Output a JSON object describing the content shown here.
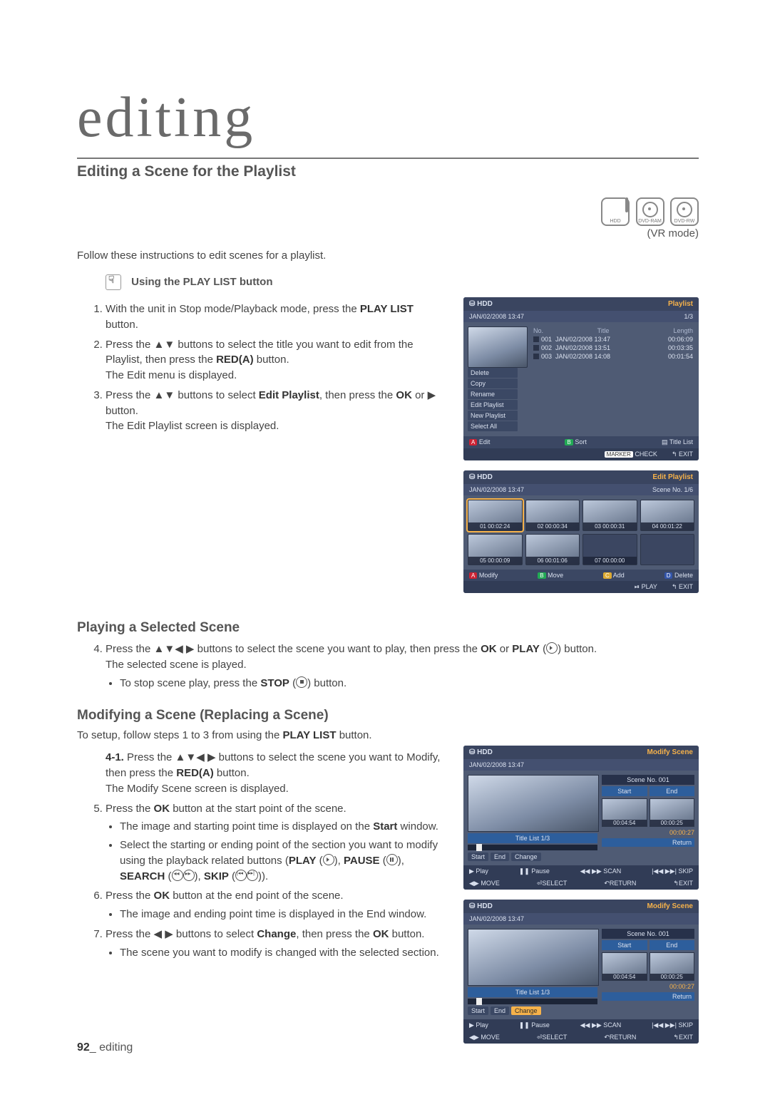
{
  "chapter_title": "editing",
  "h2": "Editing a Scene for the Playlist",
  "media_icons": {
    "hdd": "HDD",
    "dvd_ram": "DVD-RAM",
    "dvd_rw": "DVD-RW"
  },
  "vr_mode": "(VR mode)",
  "intro": "Follow these instructions to edit scenes for a playlist.",
  "using_btn": "Using the PLAY LIST button",
  "steps_1_3": [
    "With the unit in Stop mode/Playback mode, press the PLAY LIST button.",
    "Press the ▲▼ buttons to select the title you want to edit from the Playlist, then press the RED(A) button. The Edit menu is displayed.",
    "Press the ▲▼ buttons to select Edit Playlist, then press the OK or ▶ button. The Edit Playlist screen is displayed."
  ],
  "osd_playlist": {
    "hdd": "HDD",
    "corner": "Playlist",
    "datetime": "JAN/02/2008 13:47",
    "page": "1/3",
    "menu": [
      "Delete",
      "Copy",
      "Rename",
      "Edit Playlist",
      "New Playlist",
      "Select All"
    ],
    "cols": {
      "no": "No.",
      "title": "Title",
      "len": "Length"
    },
    "rows": [
      {
        "no": "001",
        "title": "JAN/02/2008 13:47",
        "len": "00:06:09"
      },
      {
        "no": "002",
        "title": "JAN/02/2008 13:51",
        "len": "00:03:35"
      },
      {
        "no": "003",
        "title": "JAN/02/2008 14:08",
        "len": "00:01:54"
      }
    ],
    "foot_edit": "Edit",
    "foot_sort": "Sort",
    "foot_titlelist": "Title List",
    "foot_check": "CHECK",
    "foot_marker": "MARKER",
    "foot_exit": "EXIT"
  },
  "osd_edit_playlist": {
    "hdd": "HDD",
    "corner": "Edit Playlist",
    "datetime": "JAN/02/2008 13:47",
    "scene_no": "Scene No. 1/6",
    "cells": [
      {
        "n": "01",
        "t": "00:02:24",
        "sel": true
      },
      {
        "n": "02",
        "t": "00:00:34"
      },
      {
        "n": "03",
        "t": "00:00:31"
      },
      {
        "n": "04",
        "t": "00:01:22"
      },
      {
        "n": "05",
        "t": "00:00:09"
      },
      {
        "n": "06",
        "t": "00:01:06"
      },
      {
        "n": "07",
        "t": "00:00:00",
        "empty": true
      },
      {
        "empty_only": true
      }
    ],
    "foot_modify": "Modify",
    "foot_move": "Move",
    "foot_add": "Add",
    "foot_delete": "Delete",
    "foot_play": "PLAY",
    "foot_exit": "EXIT"
  },
  "h3_play": "Playing a Selected Scene",
  "step4": "Press the ▲▼◀ ▶ buttons to select the scene you want to play, then press the OK or PLAY ( ) button. The selected scene is played.",
  "step4_bullet": "To stop scene play, press the STOP ( ) button.",
  "h3_modify": "Modifying a Scene (Replacing a Scene)",
  "modify_intro": "To setup, follow steps 1 to 3 from using the PLAY LIST button.",
  "step4_1_label": "4-1.",
  "step4_1": "Press the ▲▼◀ ▶ buttons to select the scene you want to Modify, then press the RED(A) button. The Modify Scene screen is displayed.",
  "steps_5_7": [
    {
      "t": "Press the OK button at the start point of the scene.",
      "b": [
        "The image and starting point time is displayed on the Start window.",
        "Select the starting or ending point of the section you want to modify using the playback related buttons (PLAY ( ), PAUSE ( ), SEARCH ( )( ), SKIP ( )( ))."
      ]
    },
    {
      "t": "Press the OK button at the end point of the scene.",
      "b": [
        "The image and ending point time is displayed in the End window."
      ]
    },
    {
      "t": "Press the ◀ ▶ buttons to select Change, then press the OK button.",
      "b": [
        "The scene you want to modify is changed with the selected section."
      ]
    }
  ],
  "osd_modify_a": {
    "hdd": "HDD",
    "corner": "Modify Scene",
    "datetime": "JAN/02/2008 13:47",
    "title_list": "Title List  1/3",
    "scene_no": "Scene No. 001",
    "start": "Start",
    "end": "End",
    "start_t": "00:04:54",
    "end_t": "00:00:25",
    "duration": "00:00:27",
    "return": "Return",
    "btns": [
      "Start",
      "End",
      "Change"
    ],
    "hl_btn": "Change",
    "foot_play": "▶ Play",
    "foot_pause": "❚❚ Pause",
    "foot_scan": "◀◀ ▶▶ SCAN",
    "foot_skip": "|◀◀ ▶▶| SKIP",
    "foot_move": "◀▶ MOVE",
    "foot_select": "SELECT",
    "foot_return": "RETURN",
    "foot_exit": "EXIT"
  },
  "osd_modify_b": {
    "hdd": "HDD",
    "corner": "Modify Scene",
    "datetime": "JAN/02/2008 13:47",
    "title_list": "Title List  1/3",
    "scene_no": "Scene No. 001",
    "start": "Start",
    "end": "End",
    "start_t": "00:04:54",
    "end_t": "00:00:25",
    "duration": "00:00:27",
    "return": "Return",
    "btns": [
      "Start",
      "End",
      "Change"
    ],
    "hl_btn": "Change",
    "foot_play": "▶ Play",
    "foot_pause": "❚❚ Pause",
    "foot_scan": "◀◀ ▶▶ SCAN",
    "foot_skip": "|◀◀ ▶▶| SKIP",
    "foot_move": "◀▶ MOVE",
    "foot_select": "SELECT",
    "foot_return": "RETURN",
    "foot_exit": "EXIT"
  },
  "footer_page": "92",
  "footer_label": "editing"
}
